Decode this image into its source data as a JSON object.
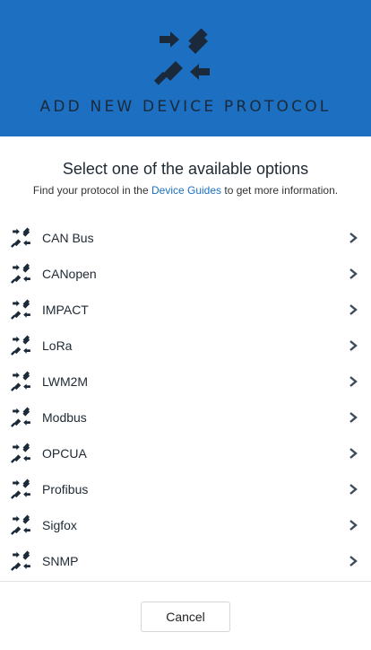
{
  "colors": {
    "header_bg": "#1c6fc1",
    "icon_dark": "#1b2a3a",
    "link": "#1c6fc1"
  },
  "header": {
    "icon": "plug-connect-icon",
    "title": "ADD NEW DEVICE PROTOCOL"
  },
  "intro": {
    "subtitle": "Select one of the available options",
    "info_prefix": "Find your protocol in the ",
    "info_link": "Device Guides",
    "info_suffix": " to get more information."
  },
  "protocols": [
    {
      "label": "CAN Bus",
      "icon": "plug-connect-icon"
    },
    {
      "label": "CANopen",
      "icon": "plug-connect-icon"
    },
    {
      "label": "IMPACT",
      "icon": "plug-connect-icon"
    },
    {
      "label": "LoRa",
      "icon": "plug-connect-icon"
    },
    {
      "label": "LWM2M",
      "icon": "plug-connect-icon"
    },
    {
      "label": "Modbus",
      "icon": "plug-connect-icon"
    },
    {
      "label": "OPCUA",
      "icon": "plug-connect-icon"
    },
    {
      "label": "Profibus",
      "icon": "plug-connect-icon"
    },
    {
      "label": "Sigfox",
      "icon": "plug-connect-icon"
    },
    {
      "label": "SNMP",
      "icon": "plug-connect-icon"
    }
  ],
  "footer": {
    "cancel_label": "Cancel"
  }
}
